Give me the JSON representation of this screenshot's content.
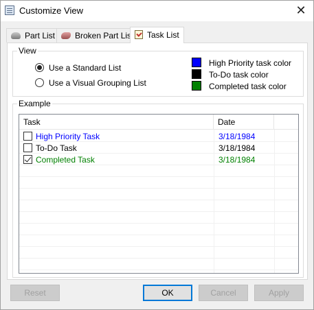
{
  "window": {
    "title": "Customize View"
  },
  "tabs": [
    {
      "label": "Part List",
      "icon": "part-list-icon"
    },
    {
      "label": "Broken Part List",
      "icon": "broken-part-list-icon"
    },
    {
      "label": "Task List",
      "icon": "task-list-icon",
      "active": true
    }
  ],
  "view": {
    "label": "View",
    "options": [
      {
        "label": "Use a Standard List",
        "selected": true
      },
      {
        "label": "Use a Visual Grouping List",
        "selected": false
      }
    ],
    "colors": [
      {
        "label": "High Priority task color",
        "color": "#0000ff"
      },
      {
        "label": "To-Do  task color",
        "color": "#000000"
      },
      {
        "label": "Completed task color",
        "color": "#008000"
      }
    ]
  },
  "example": {
    "label": "Example",
    "columns": [
      "Task",
      "Date"
    ],
    "rows": [
      {
        "task": "High Priority Task",
        "date": "3/18/1984",
        "checked": false,
        "color": "#0000ff"
      },
      {
        "task": "To-Do Task",
        "date": "3/18/1984",
        "checked": false,
        "color": "#000000"
      },
      {
        "task": "Completed Task",
        "date": "3/18/1984",
        "checked": true,
        "color": "#008000"
      }
    ]
  },
  "buttons": {
    "reset": "Reset",
    "ok": "OK",
    "cancel": "Cancel",
    "apply": "Apply"
  }
}
